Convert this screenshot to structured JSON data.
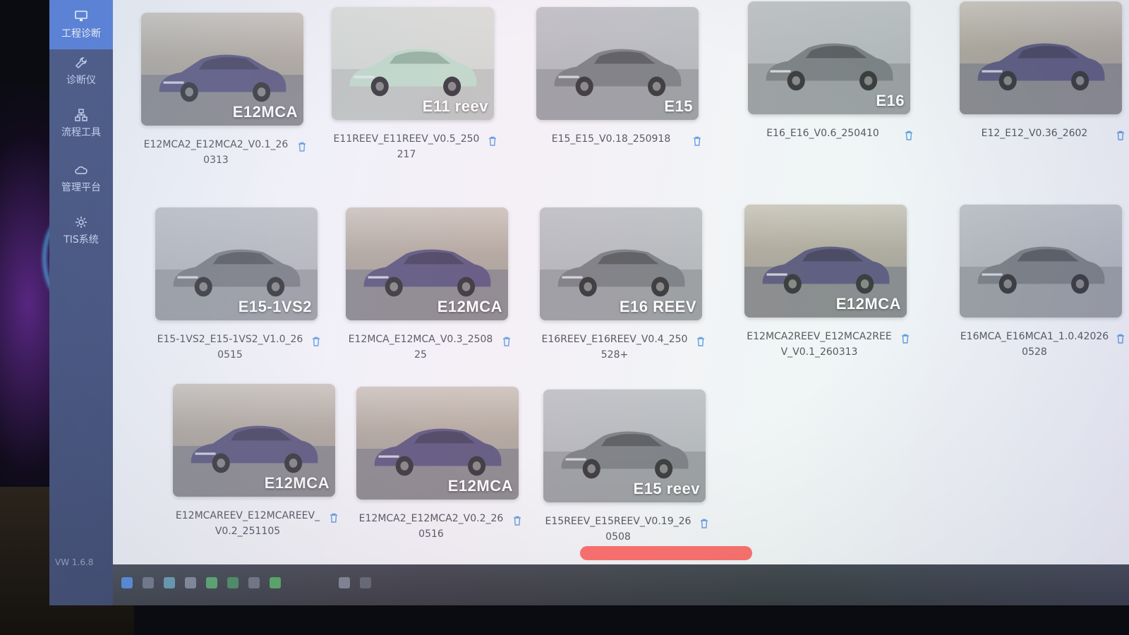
{
  "sidebar": {
    "items": [
      {
        "label": "工程诊断",
        "icon": "monitor-icon"
      },
      {
        "label": "诊断仪",
        "icon": "wrench-icon"
      },
      {
        "label": "流程工具",
        "icon": "flow-icon"
      },
      {
        "label": "管理平台",
        "icon": "cloud-icon"
      },
      {
        "label": "TIS系统",
        "icon": "gear-icon"
      }
    ],
    "active_index": 0
  },
  "footer": {
    "version": "VW 1.6.8"
  },
  "colors": {
    "sidebar": "#2c3a6e",
    "active": "#3d6bd6",
    "scroll_thumb": "#ff5a5a"
  },
  "vehicles": [
    {
      "tag": "E12MCA",
      "name": "E12MCA2_E12MCA2_V0.1_260313",
      "paint": "purple"
    },
    {
      "tag": "E11 reev",
      "name": "E11REEV_E11REEV_V0.5_250217",
      "paint": "mint"
    },
    {
      "tag": "E15",
      "name": "E15_E15_V0.18_250918",
      "paint": "gray"
    },
    {
      "tag": "E16",
      "name": "E16_E16_V0.6_250410",
      "paint": "gray"
    },
    {
      "tag": "",
      "name": "E12_E12_V0.36_2602",
      "paint": "purple"
    },
    {
      "tag": "E15-1VS2",
      "name": "E15-1VS2_E15-1VS2_V1.0_260515",
      "paint": "gray"
    },
    {
      "tag": "E12MCA",
      "name": "E12MCA_E12MCA_V0.3_250825",
      "paint": "purple"
    },
    {
      "tag": "E16 REEV",
      "name": "E16REEV_E16REEV_V0.4_250528+",
      "paint": "gray"
    },
    {
      "tag": "E12MCA",
      "name": "E12MCA2REEV_E12MCA2REEV_V0.1_260313",
      "paint": "purple"
    },
    {
      "tag": "",
      "name": "E16MCA_E16MCA1_1.0.420260528",
      "paint": "gray"
    },
    {
      "tag": "E12MCA",
      "name": "E12MCAREEV_E12MCAREEV_V0.2_251105",
      "paint": "purple"
    },
    {
      "tag": "E12MCA",
      "name": "E12MCA2_E12MCA2_V0.2_260516",
      "paint": "purple"
    },
    {
      "tag": "E15 reev",
      "name": "E15REEV_E15REEV_V0.19_260508",
      "paint": "gray"
    }
  ]
}
